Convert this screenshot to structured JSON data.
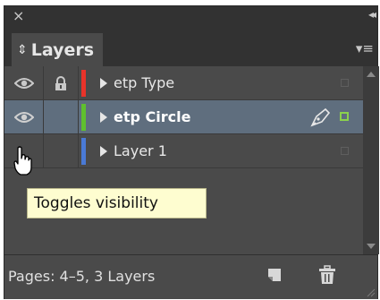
{
  "window": {
    "close_glyph": "×",
    "collapse_glyph": "◂◂"
  },
  "tab": {
    "label": "Layers",
    "updown_glyph": "⇕",
    "menu_glyph": "▾≡"
  },
  "layers": [
    {
      "name": "etp Type",
      "color": "#e8332a",
      "visible": true,
      "locked": true,
      "selected": false,
      "bold": false
    },
    {
      "name": "etp Circle",
      "color": "#5fc02e",
      "visible": true,
      "locked": false,
      "selected": true,
      "bold": true
    },
    {
      "name": "Layer 1",
      "color": "#4a7ad6",
      "visible": false,
      "locked": false,
      "selected": false,
      "bold": false
    }
  ],
  "tooltip": {
    "text": "Toggles visibility"
  },
  "footer": {
    "status": "Pages: 4–5, 3 Layers"
  },
  "icons": [
    "eye-icon",
    "lock-icon",
    "disclosure-triangle-icon",
    "pen-icon",
    "new-layer-icon",
    "trash-icon",
    "hand-cursor-icon"
  ]
}
